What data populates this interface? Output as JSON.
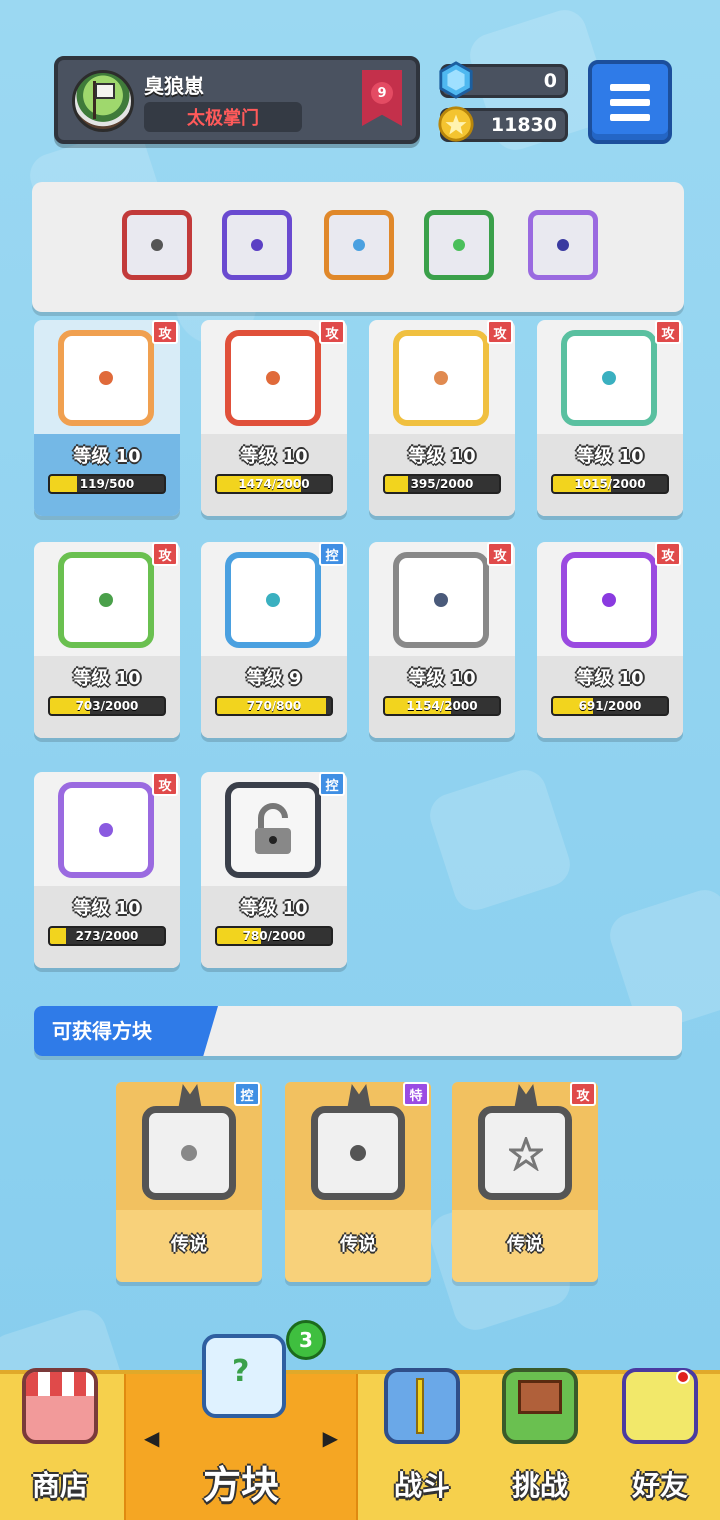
{
  "profile": {
    "player_name": "臭狼崽",
    "title": "太极掌门",
    "rank_level": "9"
  },
  "currency": {
    "gems": "0",
    "coins": "11830"
  },
  "deck": [
    {
      "name": "saw-blade-dice",
      "border": "#c23a3a",
      "dot": "#555"
    },
    {
      "name": "mirror-dice",
      "border": "#6a4ad0",
      "dot": "#5b3fc4"
    },
    {
      "name": "infinity-dice",
      "border": "#e0882a",
      "dot": "#4aa0e0"
    },
    {
      "name": "wind-dice",
      "border": "#3aa04a",
      "dot": "#4abf5a"
    },
    {
      "name": "mystery-dice",
      "border": "#9a6ae0",
      "dot": "#3a3aa0"
    }
  ],
  "cards": [
    {
      "tag": "攻",
      "tag_type": "atk",
      "level": "等级 10",
      "progress": "119/500",
      "progress_fraction": 0.24,
      "border": "#f0a050",
      "dot": "#e06a3a",
      "selected": true
    },
    {
      "tag": "攻",
      "tag_type": "atk",
      "level": "等级 10",
      "progress": "1474/2000",
      "progress_fraction": 0.74,
      "border": "#e0503a",
      "dot": "#e06a3a",
      "selected": false
    },
    {
      "tag": "攻",
      "tag_type": "atk",
      "level": "等级 10",
      "progress": "395/2000",
      "progress_fraction": 0.2,
      "border": "#f0c040",
      "dot": "#e08a50",
      "selected": false
    },
    {
      "tag": "攻",
      "tag_type": "atk",
      "level": "等级 10",
      "progress": "1015/2000",
      "progress_fraction": 0.51,
      "border": "#5ac0a0",
      "dot": "#3ab0c0",
      "selected": false
    },
    {
      "tag": "攻",
      "tag_type": "atk",
      "level": "等级 10",
      "progress": "703/2000",
      "progress_fraction": 0.35,
      "border": "#6ac050",
      "dot": "#4aa04a",
      "selected": false
    },
    {
      "tag": "控",
      "tag_type": "ctl",
      "level": "等级 9",
      "progress": "770/800",
      "progress_fraction": 0.96,
      "border": "#4aa0e0",
      "dot": "#3ab0c0",
      "selected": false
    },
    {
      "tag": "攻",
      "tag_type": "atk",
      "level": "等级 10",
      "progress": "1154/2000",
      "progress_fraction": 0.58,
      "border": "#888888",
      "dot": "#4a5a7a",
      "selected": false
    },
    {
      "tag": "攻",
      "tag_type": "atk",
      "level": "等级 10",
      "progress": "691/2000",
      "progress_fraction": 0.35,
      "border": "#9a4ae0",
      "dot": "#8a3ae0",
      "selected": false
    },
    {
      "tag": "攻",
      "tag_type": "atk",
      "level": "等级 10",
      "progress": "273/2000",
      "progress_fraction": 0.14,
      "border": "#9a6ae0",
      "dot": "#8a5ae0",
      "selected": false
    },
    {
      "tag": "控",
      "tag_type": "ctl",
      "level": "等级 10",
      "progress": "780/2000",
      "progress_fraction": 0.39,
      "border": "#3a3f4a",
      "dot": "#222",
      "selected": false,
      "locked": true
    }
  ],
  "obtainable": {
    "header": "可获得方块",
    "items": [
      {
        "tag": "控",
        "tag_type": "ctl",
        "rarity": "传说"
      },
      {
        "tag": "特",
        "tag_type": "spc",
        "rarity": "传说"
      },
      {
        "tag": "攻",
        "tag_type": "atk",
        "rarity": "传说"
      }
    ]
  },
  "nav": {
    "shop": "商店",
    "dice": "方块",
    "battle": "战斗",
    "challenge": "挑战",
    "friends": "好友",
    "dice_badge": "3",
    "left_arrow": "◀",
    "right_arrow": "▶"
  },
  "colors": {
    "accent_blue": "#2f7be8",
    "nav_yellow": "#f6d04c",
    "nav_active": "#f5a623"
  }
}
